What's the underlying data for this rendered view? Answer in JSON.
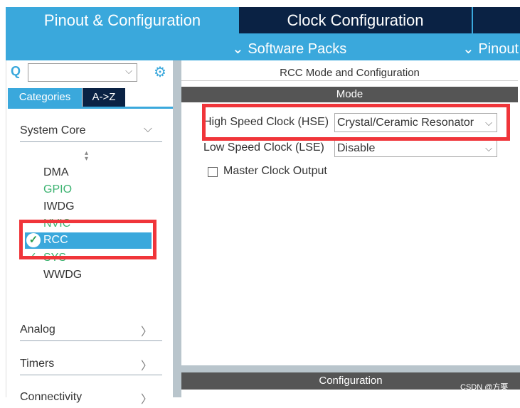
{
  "tabs": [
    {
      "label": "Pinout & Configuration",
      "active": true
    },
    {
      "label": "Clock Configuration",
      "active": false
    },
    {
      "label": "",
      "active": false
    }
  ],
  "subbar": {
    "software_packs": "Software Packs",
    "pinout": "Pinout"
  },
  "sidebar": {
    "search_placeholder": "",
    "tab_categories": "Categories",
    "tab_az": "A->Z",
    "system_core": "System Core",
    "items": [
      {
        "label": "DMA",
        "color": "#333333"
      },
      {
        "label": "GPIO",
        "color": "#3cb371"
      },
      {
        "label": "IWDG",
        "color": "#333333"
      },
      {
        "label": "NVIC",
        "color": "#3cb371"
      },
      {
        "label": "RCC",
        "selected": true
      },
      {
        "label": "SYS",
        "color": "#3cb371"
      },
      {
        "label": "WWDG",
        "color": "#333333"
      }
    ],
    "categories": [
      "Analog",
      "Timers",
      "Connectivity"
    ]
  },
  "main": {
    "title": "RCC Mode and Configuration",
    "mode_header": "Mode",
    "hse_label": "High Speed Clock (HSE)",
    "hse_value": "Crystal/Ceramic Resonator",
    "lse_label": "Low Speed Clock (LSE)",
    "lse_value": "Disable",
    "mco_label": "Master Clock Output",
    "mco_checked": false,
    "config_header": "Configuration"
  },
  "watermark": "CSDN @方栗",
  "colors": {
    "accent": "#3aa8dc",
    "navy": "#0a2244",
    "highlight": "#f0353a"
  }
}
